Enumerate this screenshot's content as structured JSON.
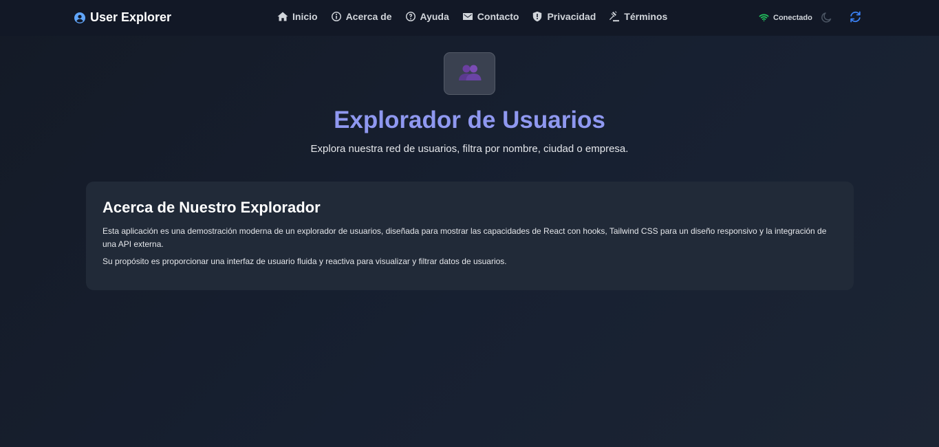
{
  "header": {
    "brand": "User Explorer",
    "nav": [
      {
        "label": "Inicio",
        "icon": "home-icon"
      },
      {
        "label": "Acerca de",
        "icon": "info-icon"
      },
      {
        "label": "Ayuda",
        "icon": "help-icon"
      },
      {
        "label": "Contacto",
        "icon": "mail-icon"
      },
      {
        "label": "Privacidad",
        "icon": "shield-icon"
      },
      {
        "label": "Términos",
        "icon": "gavel-icon"
      }
    ],
    "status": "Conectado",
    "status_icon": "wifi-icon",
    "theme_icon": "moon-icon",
    "refresh_icon": "refresh-icon"
  },
  "hero": {
    "icon": "users-icon",
    "title": "Explorador de Usuarios",
    "subtitle": "Explora nuestra red de usuarios, filtra por nombre, ciudad o empresa."
  },
  "about": {
    "title": "Acerca de Nuestro Explorador",
    "paragraph1": "Esta aplicación es una demostración moderna de un explorador de usuarios, diseñada para mostrar las capacidades de React con hooks, Tailwind CSS para un diseño responsivo y la integración de una API externa.",
    "paragraph2": "Su propósito es proporcionar una interfaz de usuario fluida y reactiva para visualizar y filtrar datos de usuarios."
  },
  "colors": {
    "accent": "#8f98f0",
    "brand_icon": "#60a5fa",
    "status_green": "#22c55e",
    "refresh_blue": "#3b82f6"
  }
}
